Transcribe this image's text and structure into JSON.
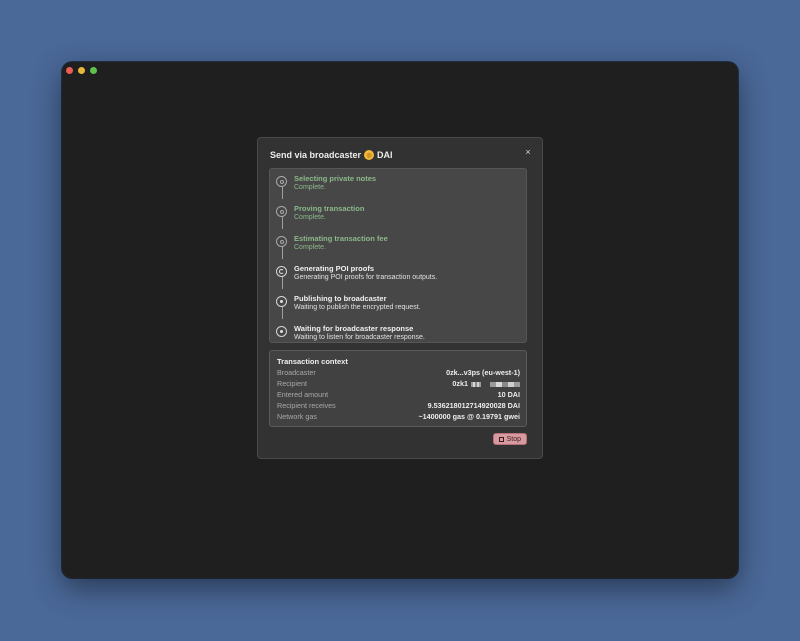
{
  "dialog": {
    "title_prefix": "Send via broadcaster",
    "token": "DAI",
    "token_coin_glyph": "◎",
    "close_glyph": "×",
    "stop_label": "Stop"
  },
  "steps": [
    {
      "title": "Selecting private notes",
      "desc": "Complete.",
      "state": "complete"
    },
    {
      "title": "Proving transaction",
      "desc": "Complete.",
      "state": "complete"
    },
    {
      "title": "Estimating transaction fee",
      "desc": "Complete.",
      "state": "complete"
    },
    {
      "title": "Generating POI proofs",
      "desc": "Generating POI proofs for transaction outputs.",
      "state": "active"
    },
    {
      "title": "Publishing to broadcaster",
      "desc": "Waiting to publish the encrypted request.",
      "state": "pending"
    },
    {
      "title": "Waiting for broadcaster response",
      "desc": "Waiting to listen for broadcaster response.",
      "state": "pending"
    }
  ],
  "context": {
    "title": "Transaction context",
    "rows": [
      {
        "label": "Broadcaster",
        "value": "0zk...v3ps (eu-west-1)"
      },
      {
        "label": "Recipient",
        "value": "0zk1"
      },
      {
        "label": "Entered amount",
        "value": "10 DAI"
      },
      {
        "label": "Recipient receives",
        "value": "9.536218012714920028 DAI"
      },
      {
        "label": "Network gas",
        "value": "~1400000 gas @ 0.19791 gwei"
      }
    ]
  },
  "colors": {
    "background": "#4a6898",
    "window": "#1f1f1f",
    "complete_text": "#8cb88a",
    "stop_button": "#d79aa0",
    "coin": "#f3b63b"
  }
}
